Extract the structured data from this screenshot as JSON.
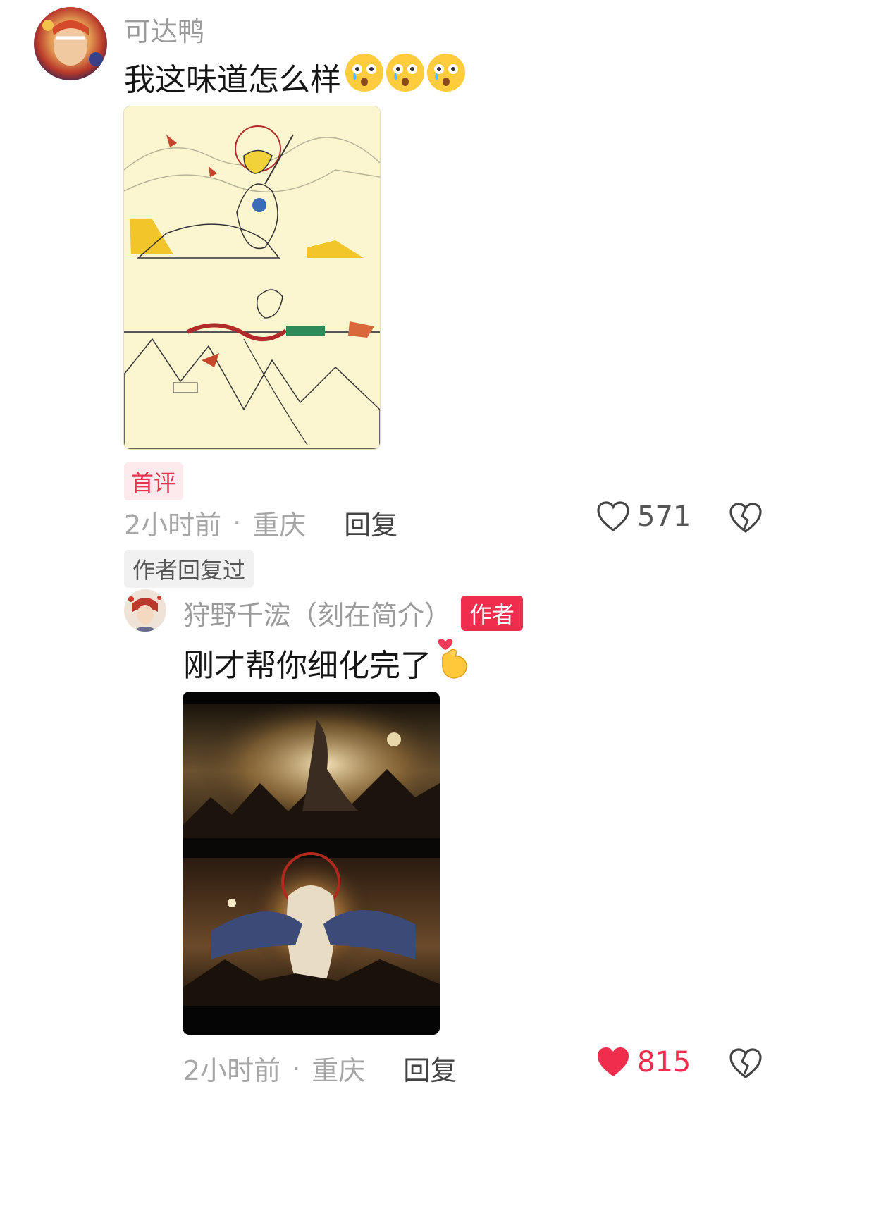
{
  "comment": {
    "username": "可达鸭",
    "text": "我这味道怎么样",
    "badge": "首评",
    "time": "2小时前",
    "location": "重庆",
    "reply_label": "回复",
    "likes": "571",
    "author_replied_tag": "作者回复过"
  },
  "reply": {
    "username": "狩野千浤（刻在简介）",
    "author_badge": "作者",
    "text": "刚才帮你细化完了",
    "time": "2小时前",
    "location": "重庆",
    "reply_label": "回复",
    "likes": "815"
  },
  "colors": {
    "like_active": "#ef2d4d",
    "badge_red": "#ef2d4d"
  }
}
